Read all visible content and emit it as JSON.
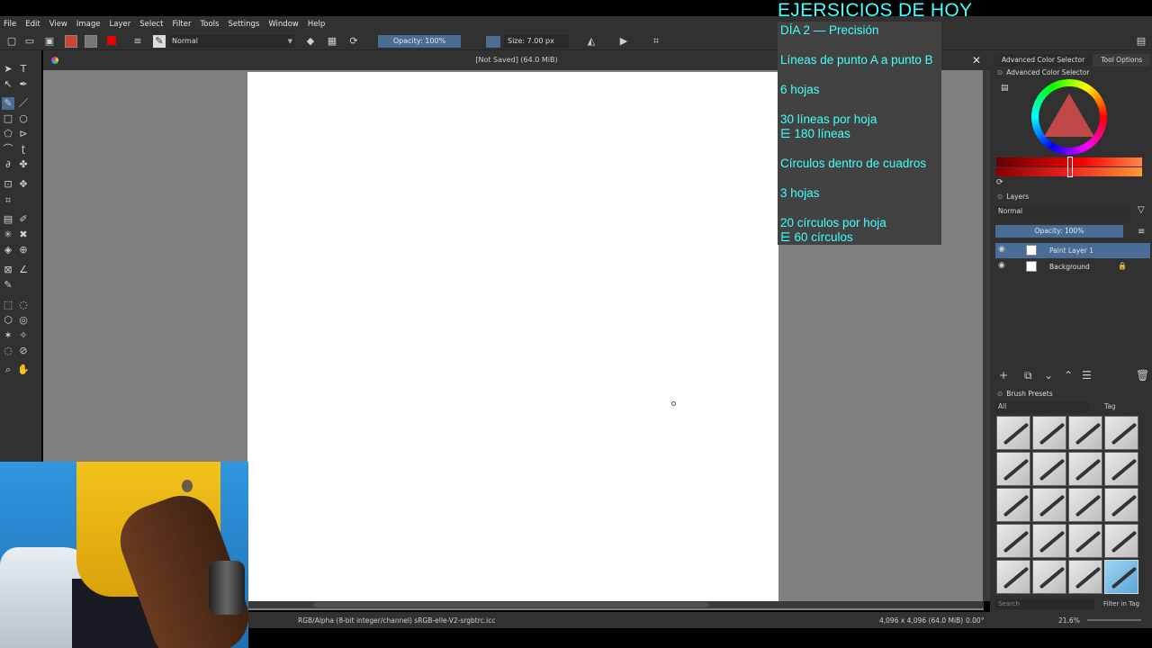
{
  "overlay": {
    "title": "EJERSICIOS DE HOY",
    "lines": [
      "DÍA 2 — Precisión",
      "Líneas de punto A a punto B",
      "6 hojas",
      "30 líneas por hoja",
      "⋿ 180 líneas",
      "Círculos dentro de cuadros",
      "3 hojas",
      "20 círculos por hoja",
      "⋿ 60 círculos"
    ]
  },
  "menu": [
    "File",
    "Edit",
    "View",
    "Image",
    "Layer",
    "Select",
    "Filter",
    "Tools",
    "Settings",
    "Window",
    "Help"
  ],
  "toolbar": {
    "blend_mode": "Normal",
    "opacity": "Opacity: 100%",
    "size": "Size: 7.00 px"
  },
  "document": {
    "title": "[Not Saved]  (64.0 MiB)"
  },
  "dock": {
    "tabs": [
      "Advanced Color Selector",
      "Tool Options"
    ],
    "color_panel_title": "Advanced Color Selector",
    "layers_title": "Layers",
    "layers_blend": "Normal",
    "layers_opacity": "Opacity:  100%",
    "layers": [
      {
        "name": "Paint Layer 1",
        "selected": true
      },
      {
        "name": "Background",
        "selected": false
      }
    ],
    "brush_title": "Brush Presets",
    "brush_filter": "All",
    "brush_tag": "Tag",
    "brush_search": "Search",
    "brush_filter_in_tag": "Filter in Tag"
  },
  "status": {
    "color_space": "RGB/Alpha (8-bit integer/channel)  sRGB-elle-V2-srgbtrc.icc",
    "dimensions": "4,096 x 4,096 (64.0 MiB)",
    "rotation": "0.00°",
    "zoom": "21.6%"
  },
  "colors": {
    "accent": "#4a6d96",
    "overlay_text": "#44ffff",
    "panel_bg": "#313131",
    "canvas_bg": "#808080"
  }
}
